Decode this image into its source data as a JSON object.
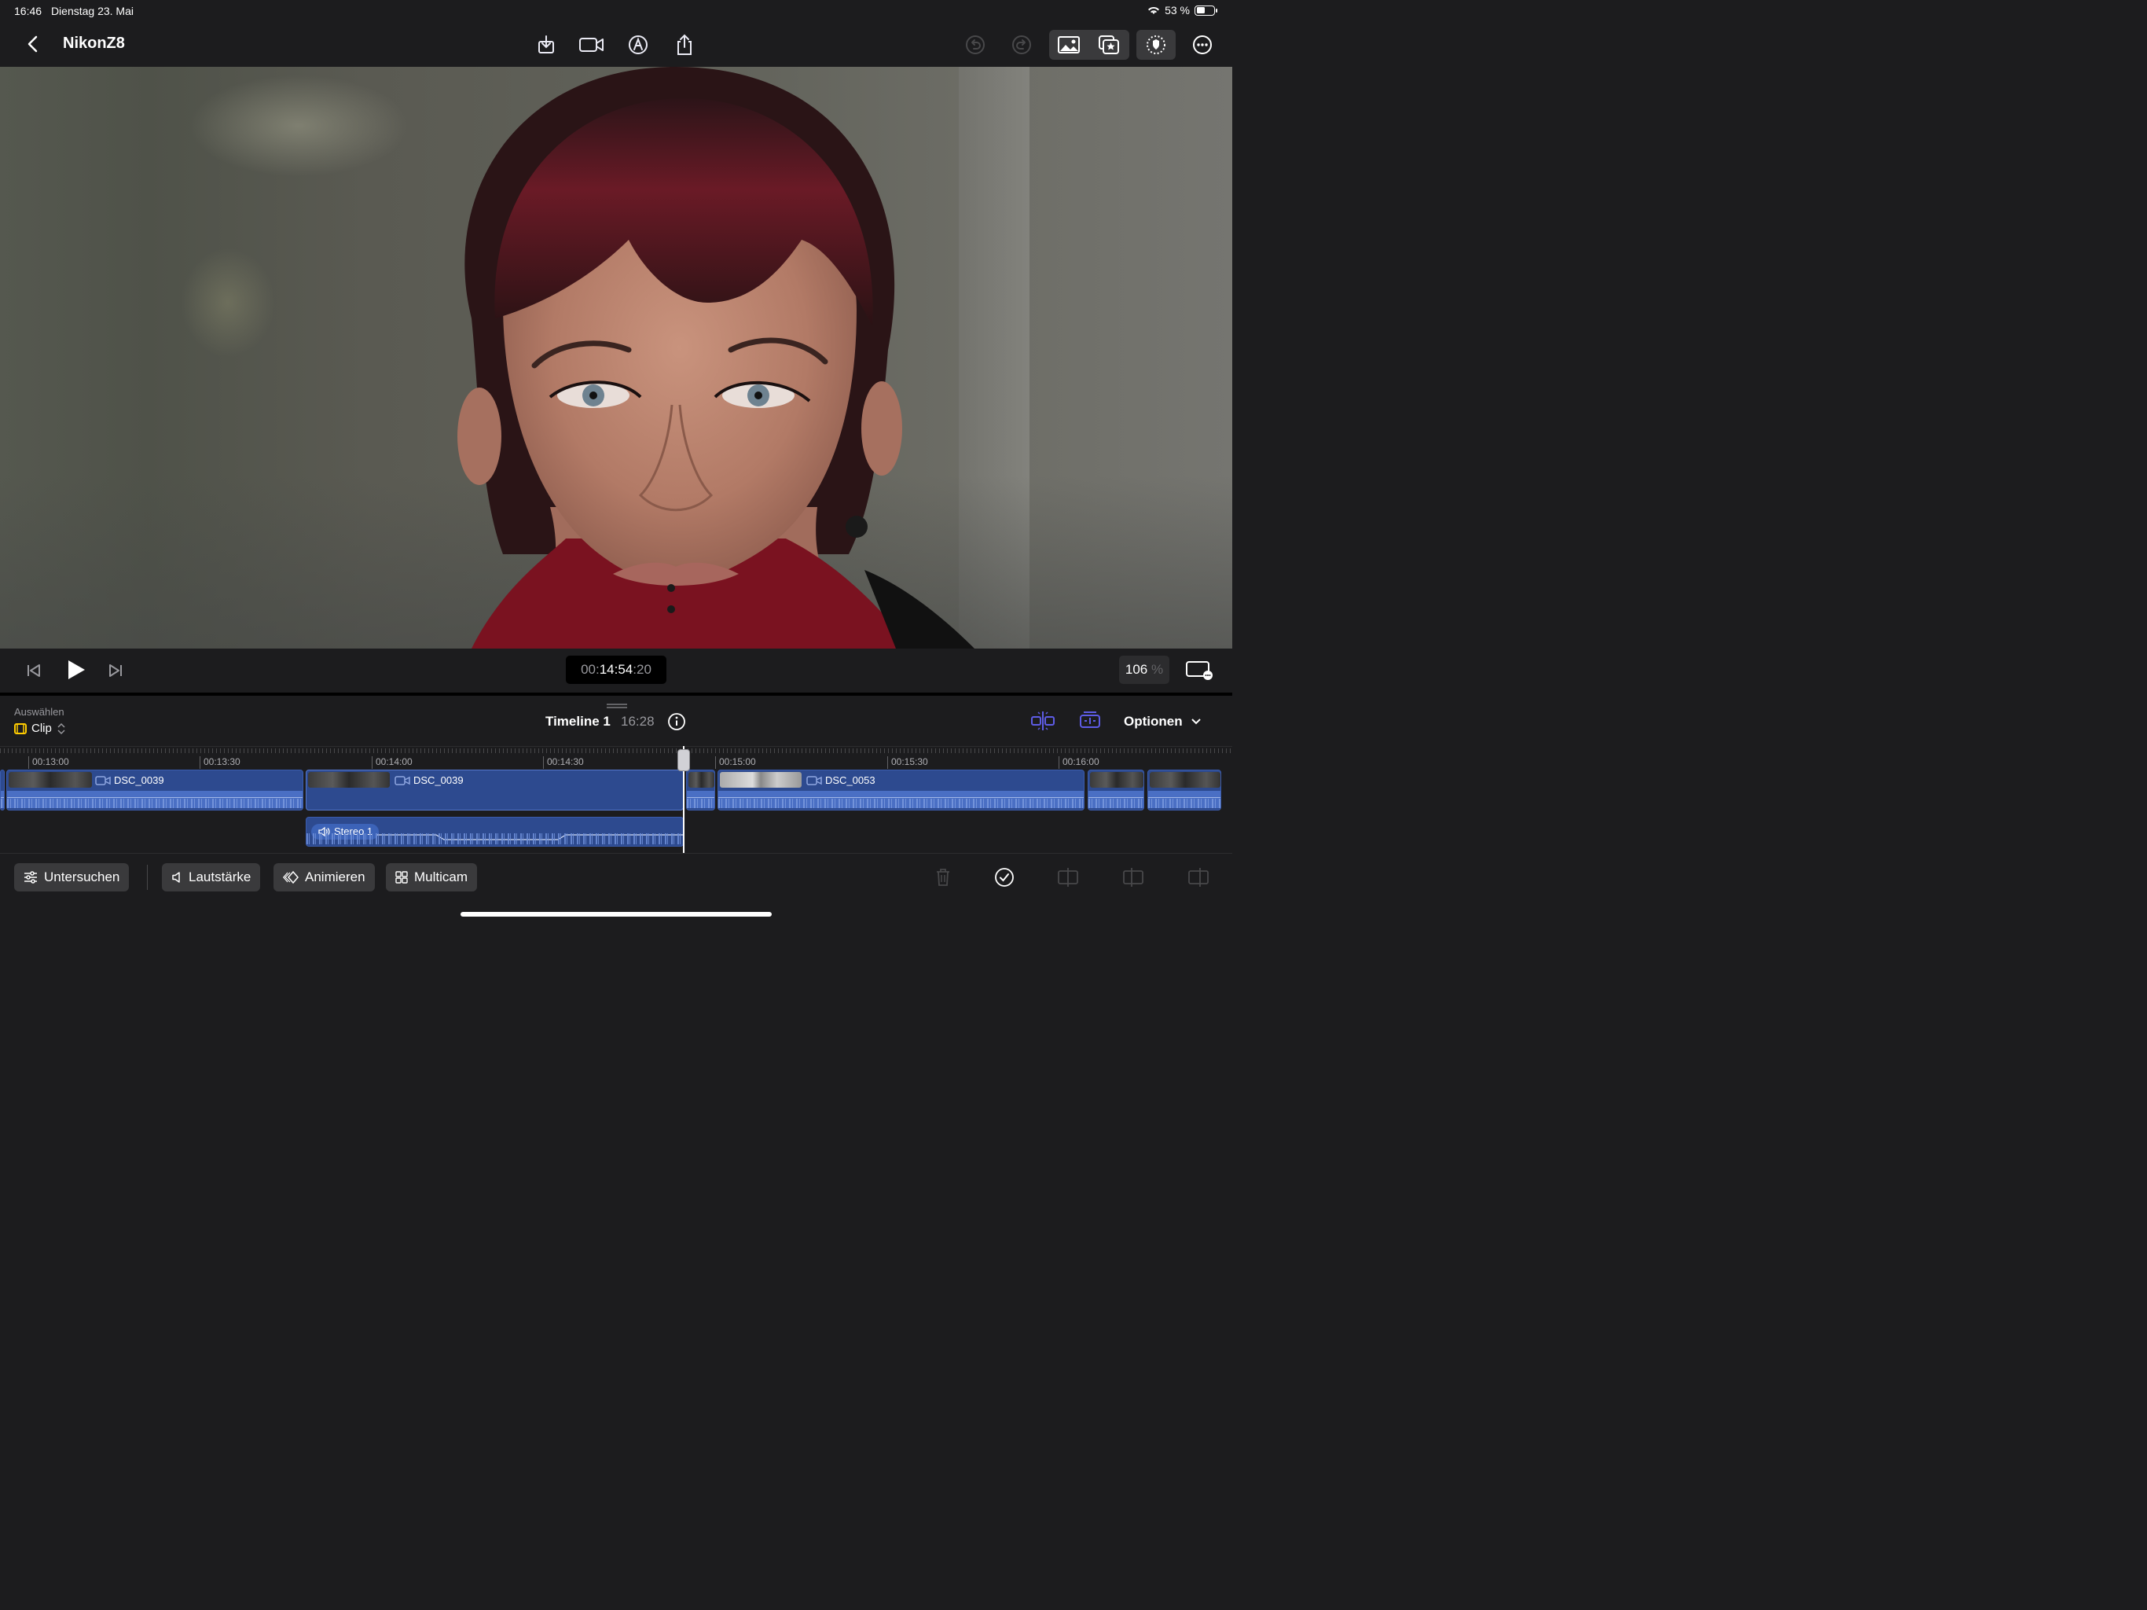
{
  "status_bar": {
    "time": "16:46",
    "date": "Dienstag 23. Mai",
    "battery_percent": "53 %",
    "battery_level": 0.53
  },
  "toolbar": {
    "project_title": "NikonZ8",
    "icons": [
      "back-chevron-icon",
      "import-icon",
      "camera-icon",
      "voiceover-icon",
      "share-icon",
      "undo-icon",
      "redo-icon",
      "photos-icon",
      "favorites-icon",
      "stabilize-icon",
      "more-icon"
    ]
  },
  "transport": {
    "timecode_prefix": "00:",
    "timecode_main": "14:54",
    "timecode_frames": ":20",
    "zoom_value": "106",
    "zoom_unit": "%"
  },
  "timeline_header": {
    "select_label": "Auswählen",
    "select_value": "Clip",
    "timeline_name": "Timeline 1",
    "timeline_duration": "16:28",
    "options_label": "Optionen"
  },
  "ruler": {
    "labels": [
      "00:13:00",
      "00:13:30",
      "00:14:00",
      "00:14:30",
      "00:15:00",
      "00:15:30",
      "00:16:00"
    ]
  },
  "clips": [
    {
      "name": "DSC_0039"
    },
    {
      "name": "DSC_0039"
    },
    {
      "name": ""
    },
    {
      "name": "DSC_0053"
    },
    {
      "name": ""
    },
    {
      "name": ""
    }
  ],
  "audio_clip": {
    "name": "Stereo 1"
  },
  "bottom_bar": {
    "inspect_label": "Untersuchen",
    "volume_label": "Lautstärke",
    "animate_label": "Animieren",
    "multicam_label": "Multicam"
  },
  "colors": {
    "accent": "#5e5ce6",
    "clip_blue": "#2d4a8f",
    "clip_select_yellow": "#ffcc00"
  }
}
